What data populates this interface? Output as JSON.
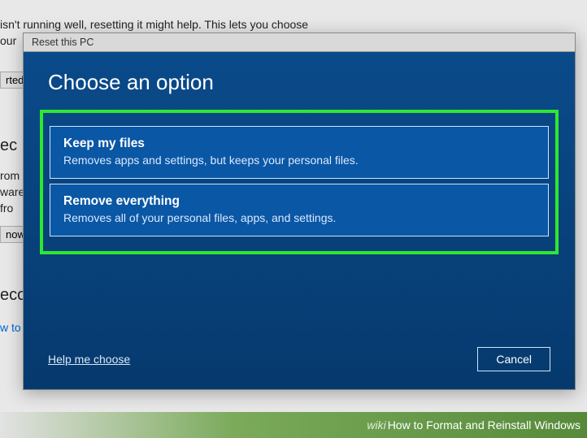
{
  "background": {
    "line1": "isn't running well, resetting it might help. This lets you choose",
    "line2": "our",
    "btn1": "rted",
    "word_ec": "ec",
    "word_rom": "rom",
    "word_ware": "ware",
    "word_fro": " fro",
    "btn2": "now",
    "word_eco": "eco",
    "link_wto": "w to"
  },
  "dialog": {
    "titlebar": "Reset this PC",
    "heading": "Choose an option",
    "options": [
      {
        "title": "Keep my files",
        "desc": "Removes apps and settings, but keeps your personal files."
      },
      {
        "title": "Remove everything",
        "desc": "Removes all of your personal files, apps, and settings."
      }
    ],
    "help": "Help me choose",
    "cancel": "Cancel"
  },
  "caption": {
    "brand": "wiki",
    "text": "How to Format and Reinstall Windows"
  }
}
